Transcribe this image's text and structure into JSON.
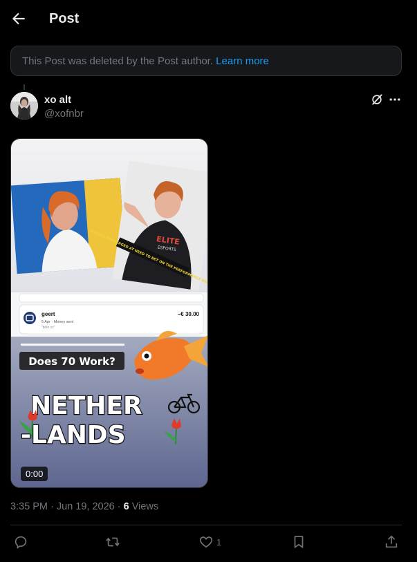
{
  "header": {
    "title": "Post",
    "back_icon": "arrow-left-icon"
  },
  "banner": {
    "text": "This Post was deleted by the Post author. ",
    "link": "Learn more"
  },
  "post": {
    "name": "xo alt",
    "handle": "@xofnbr",
    "media": {
      "timestamp": "0:00",
      "payment": {
        "name": "geert",
        "date": "5 Apr · Money sent",
        "note": "\"bolo cc\"",
        "amount": "−€ 30.00"
      },
      "question": "Does 70 Work?",
      "headline_1": "NETHER",
      "headline_2": "-LANDS",
      "shirt_text": "ELITE",
      "shirt_sub": "ESPORTS",
      "caption": "EUROPE SUBMERGED AT NEED TO BET ON THE PERFORMANCE BELOW"
    },
    "time": "3:35 PM · Jun 19, 2026 · ",
    "views_count": "6",
    "views_label": " Views"
  },
  "actions": {
    "likes": "1"
  },
  "colors": {
    "accent": "#1d9bf0",
    "text_muted": "#71767b",
    "text": "#e7e9ea",
    "bg": "#000000"
  }
}
